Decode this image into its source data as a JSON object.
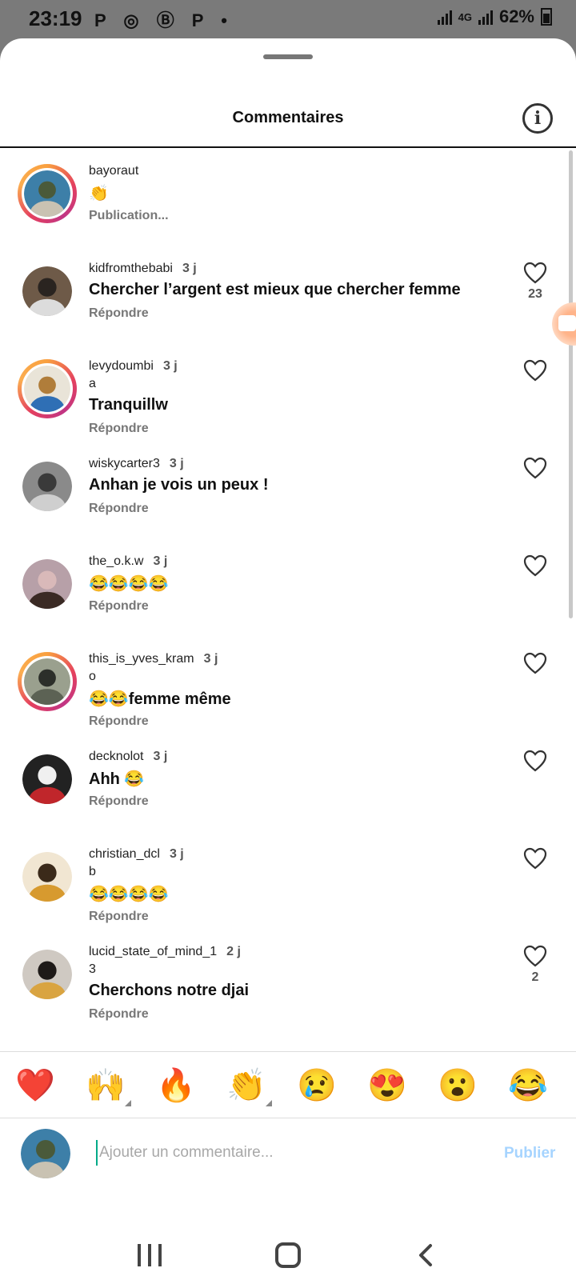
{
  "status_bar": {
    "time": "23:19",
    "notification_icons": "P ◎ Ⓑ P •",
    "network": "4G",
    "battery": "62%"
  },
  "sheet": {
    "title": "Commentaires",
    "info_label": "i"
  },
  "comments": [
    {
      "username": "bayoraut",
      "time": "",
      "sub": "",
      "text": "👏",
      "action": "Publication...",
      "likes": "",
      "story_ring": true,
      "avatar_colors": [
        "#4a5a3a",
        "#c9c2b2",
        "#3d7fa8"
      ]
    },
    {
      "username": "kidfromthebabi",
      "time": "3 j",
      "sub": "",
      "text": "Chercher l’argent est mieux que chercher femme",
      "action": "Répondre",
      "likes": "23",
      "story_ring": false,
      "avatar_colors": [
        "#2a2420",
        "#dcdcdc",
        "#6e5a48"
      ]
    },
    {
      "username": "levydoumbi",
      "time": "3 j",
      "sub": "a",
      "text": "Tranquillw",
      "action": "Répondre",
      "likes": "",
      "story_ring": true,
      "avatar_colors": [
        "#b07d3a",
        "#2f6fb5",
        "#e9e4d8"
      ]
    },
    {
      "username": "wiskycarter3",
      "time": "3 j",
      "sub": "",
      "text": "Anhan je vois un peux !",
      "action": "Répondre",
      "likes": "",
      "story_ring": false,
      "avatar_colors": [
        "#3a3a3a",
        "#cfcfcf",
        "#8a8a8a"
      ]
    },
    {
      "username": "the_o.k.w",
      "time": "3 j",
      "sub": "",
      "text": "😂😂😂😂",
      "action": "Répondre",
      "likes": "",
      "story_ring": false,
      "avatar_colors": [
        "#d9b9b9",
        "#3a2a24",
        "#b7a0a8"
      ]
    },
    {
      "username": "this_is_yves_kram",
      "time": "3 j",
      "sub": "o",
      "text": "😂😂femme même",
      "action": "Répondre",
      "likes": "",
      "story_ring": true,
      "avatar_colors": [
        "#2c2f2a",
        "#5c6254",
        "#9aa08e"
      ]
    },
    {
      "username": "decknolot",
      "time": "3 j",
      "sub": "",
      "text": "Ahh 😂",
      "action": "Répondre",
      "likes": "",
      "story_ring": false,
      "avatar_colors": [
        "#f0f0f0",
        "#c0262b",
        "#222222"
      ]
    },
    {
      "username": "christian_dcl",
      "time": "3 j",
      "sub": "b",
      "text": "😂😂😂😂",
      "action": "Répondre",
      "likes": "",
      "story_ring": false,
      "avatar_colors": [
        "#3b2a1a",
        "#d79a2f",
        "#f1e6d2"
      ]
    },
    {
      "username": "lucid_state_of_mind_1",
      "time": "2 j",
      "sub": "3",
      "text": "Cherchons notre djai",
      "action": "Répondre",
      "likes": "2",
      "story_ring": false,
      "avatar_colors": [
        "#1e1a18",
        "#d9a441",
        "#cfc9c2"
      ]
    }
  ],
  "reactions": [
    {
      "emoji": "❤️",
      "has_skin": false
    },
    {
      "emoji": "🙌",
      "has_skin": true
    },
    {
      "emoji": "🔥",
      "has_skin": false
    },
    {
      "emoji": "👏",
      "has_skin": true
    },
    {
      "emoji": "😢",
      "has_skin": false
    },
    {
      "emoji": "😍",
      "has_skin": false
    },
    {
      "emoji": "😮",
      "has_skin": false
    },
    {
      "emoji": "😂",
      "has_skin": false
    }
  ],
  "composer": {
    "placeholder": "Ajouter un commentaire...",
    "value": "",
    "publish_label": "Publier",
    "avatar_colors": [
      "#4a5a3a",
      "#c9c2b2",
      "#3d7fa8"
    ]
  },
  "colors": {
    "accent_disabled": "#a6d4ff",
    "secondary_text": "#777777",
    "story_ring": "#e4405f"
  }
}
